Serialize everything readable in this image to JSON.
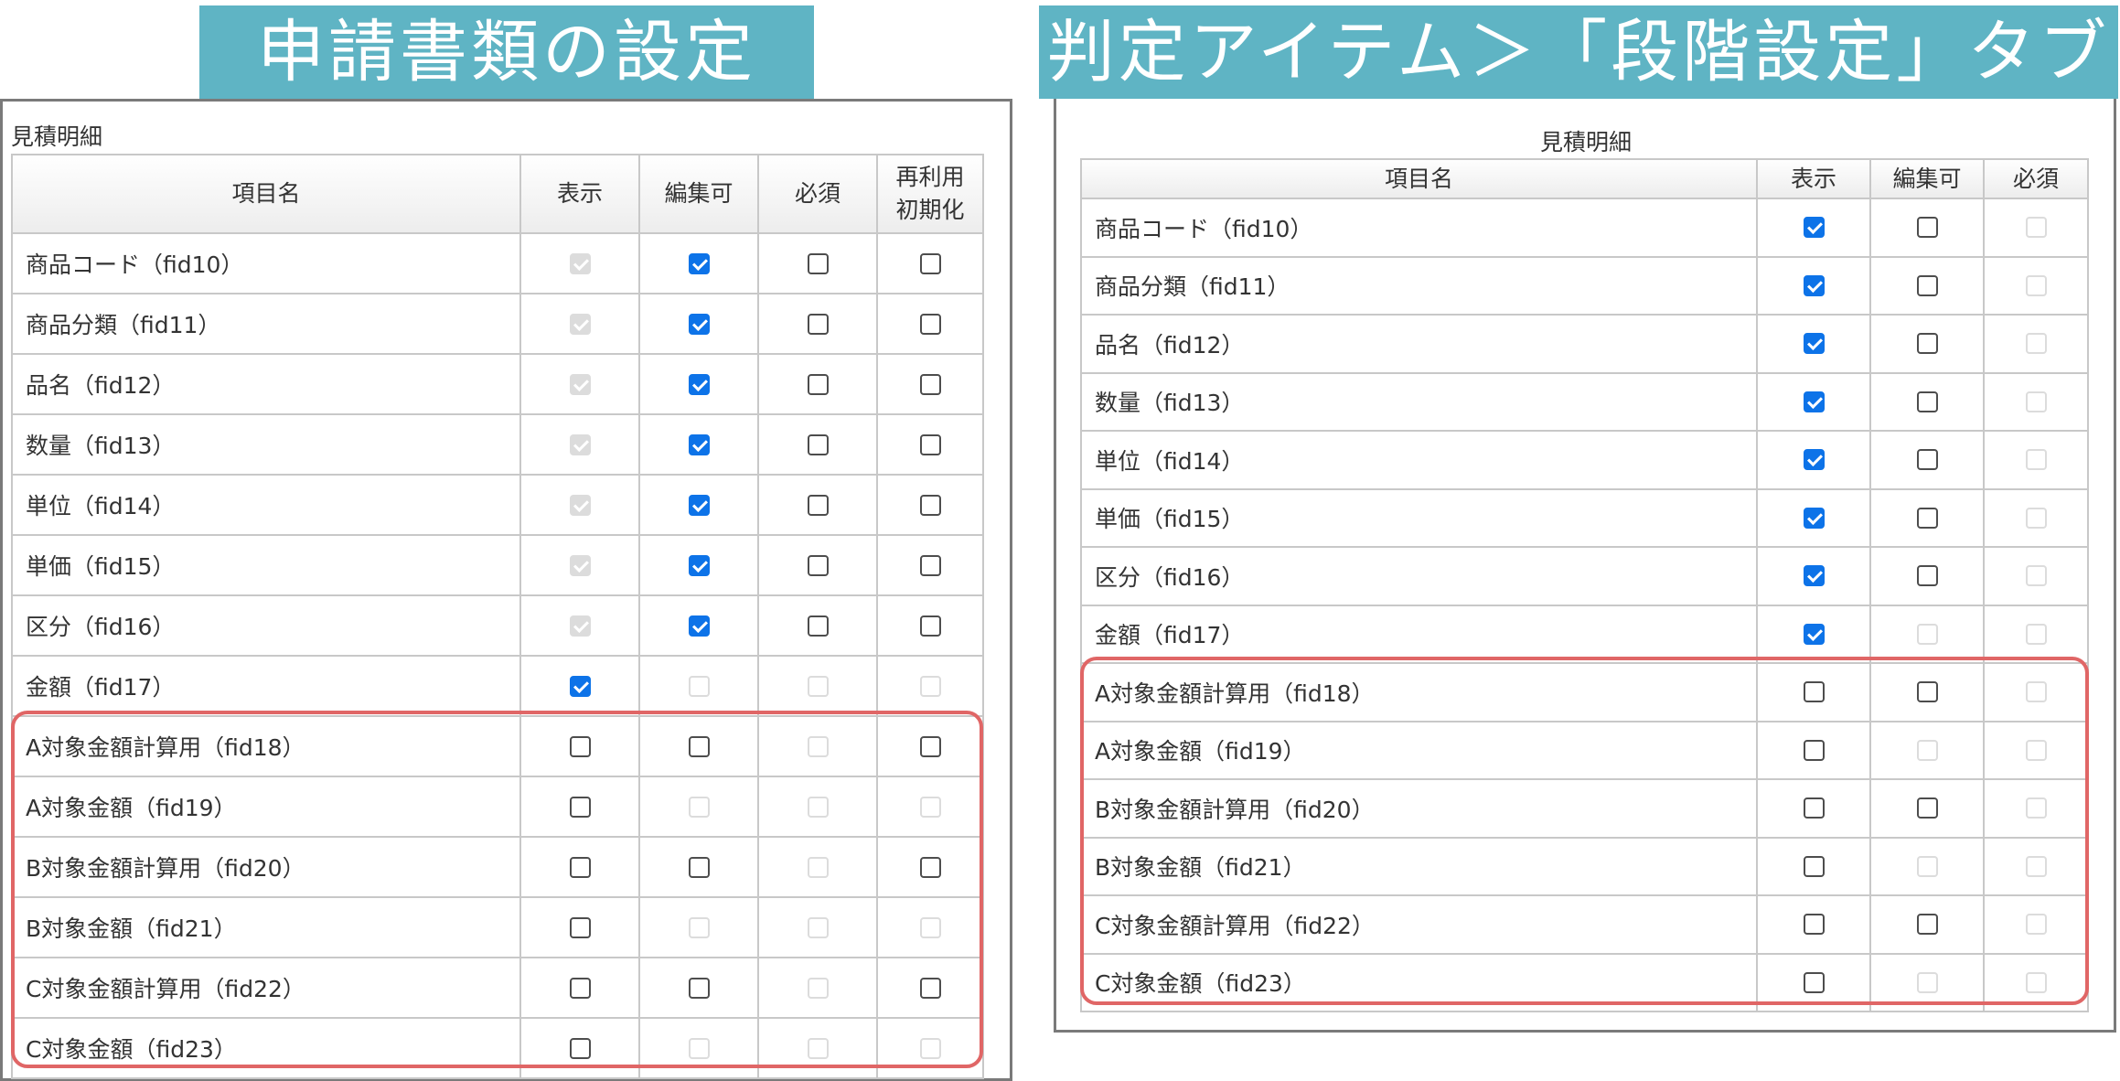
{
  "left": {
    "banner_title": "申請書類の設定",
    "caption": "見積明細",
    "columns": [
      "項目名",
      "表示",
      "編集可",
      "必須",
      "再利用\n初期化"
    ],
    "rows": [
      {
        "name": "商品コード（fid10）",
        "cb": [
          "disabled-checked",
          "checked",
          "unchecked",
          "unchecked"
        ]
      },
      {
        "name": "商品分類（fid11）",
        "cb": [
          "disabled-checked",
          "checked",
          "unchecked",
          "unchecked"
        ]
      },
      {
        "name": "品名（fid12）",
        "cb": [
          "disabled-checked",
          "checked",
          "unchecked",
          "unchecked"
        ]
      },
      {
        "name": "数量（fid13）",
        "cb": [
          "disabled-checked",
          "checked",
          "unchecked",
          "unchecked"
        ]
      },
      {
        "name": "単位（fid14）",
        "cb": [
          "disabled-checked",
          "checked",
          "unchecked",
          "unchecked"
        ]
      },
      {
        "name": "単価（fid15）",
        "cb": [
          "disabled-checked",
          "checked",
          "unchecked",
          "unchecked"
        ]
      },
      {
        "name": "区分（fid16）",
        "cb": [
          "disabled-checked",
          "checked",
          "unchecked",
          "unchecked"
        ]
      },
      {
        "name": "金額（fid17）",
        "cb": [
          "checked",
          "disabled",
          "disabled",
          "disabled"
        ]
      },
      {
        "name": "A対象金額計算用（fid18）",
        "cb": [
          "unchecked",
          "unchecked",
          "disabled",
          "unchecked"
        ]
      },
      {
        "name": "A対象金額（fid19）",
        "cb": [
          "unchecked",
          "disabled",
          "disabled",
          "disabled"
        ]
      },
      {
        "name": "B対象金額計算用（fid20）",
        "cb": [
          "unchecked",
          "unchecked",
          "disabled",
          "unchecked"
        ]
      },
      {
        "name": "B対象金額（fid21）",
        "cb": [
          "unchecked",
          "disabled",
          "disabled",
          "disabled"
        ]
      },
      {
        "name": "C対象金額計算用（fid22）",
        "cb": [
          "unchecked",
          "unchecked",
          "disabled",
          "unchecked"
        ]
      },
      {
        "name": "C対象金額（fid23）",
        "cb": [
          "unchecked",
          "disabled",
          "disabled",
          "disabled"
        ]
      }
    ]
  },
  "right": {
    "banner_title": "判定アイテム＞「段階設定」タブ",
    "caption": "見積明細",
    "columns": [
      "項目名",
      "表示",
      "編集可",
      "必須"
    ],
    "rows": [
      {
        "name": "商品コード（fid10）",
        "cb": [
          "checked",
          "unchecked",
          "disabled"
        ]
      },
      {
        "name": "商品分類（fid11）",
        "cb": [
          "checked",
          "unchecked",
          "disabled"
        ]
      },
      {
        "name": "品名（fid12）",
        "cb": [
          "checked",
          "unchecked",
          "disabled"
        ]
      },
      {
        "name": "数量（fid13）",
        "cb": [
          "checked",
          "unchecked",
          "disabled"
        ]
      },
      {
        "name": "単位（fid14）",
        "cb": [
          "checked",
          "unchecked",
          "disabled"
        ]
      },
      {
        "name": "単価（fid15）",
        "cb": [
          "checked",
          "unchecked",
          "disabled"
        ]
      },
      {
        "name": "区分（fid16）",
        "cb": [
          "checked",
          "unchecked",
          "disabled"
        ]
      },
      {
        "name": "金額（fid17）",
        "cb": [
          "checked",
          "disabled",
          "disabled"
        ]
      },
      {
        "name": "A対象金額計算用（fid18）",
        "cb": [
          "unchecked",
          "unchecked",
          "disabled"
        ]
      },
      {
        "name": "A対象金額（fid19）",
        "cb": [
          "unchecked",
          "disabled",
          "disabled"
        ]
      },
      {
        "name": "B対象金額計算用（fid20）",
        "cb": [
          "unchecked",
          "unchecked",
          "disabled"
        ]
      },
      {
        "name": "B対象金額（fid21）",
        "cb": [
          "unchecked",
          "disabled",
          "disabled"
        ]
      },
      {
        "name": "C対象金額計算用（fid22）",
        "cb": [
          "unchecked",
          "unchecked",
          "disabled"
        ]
      },
      {
        "name": "C対象金額（fid23）",
        "cb": [
          "unchecked",
          "disabled",
          "disabled"
        ]
      }
    ]
  },
  "colors": {
    "banner": "#5fb4c4",
    "checkbox_checked": "#0d73e8",
    "highlight": "#e06666",
    "border": "#c8c8c8"
  }
}
